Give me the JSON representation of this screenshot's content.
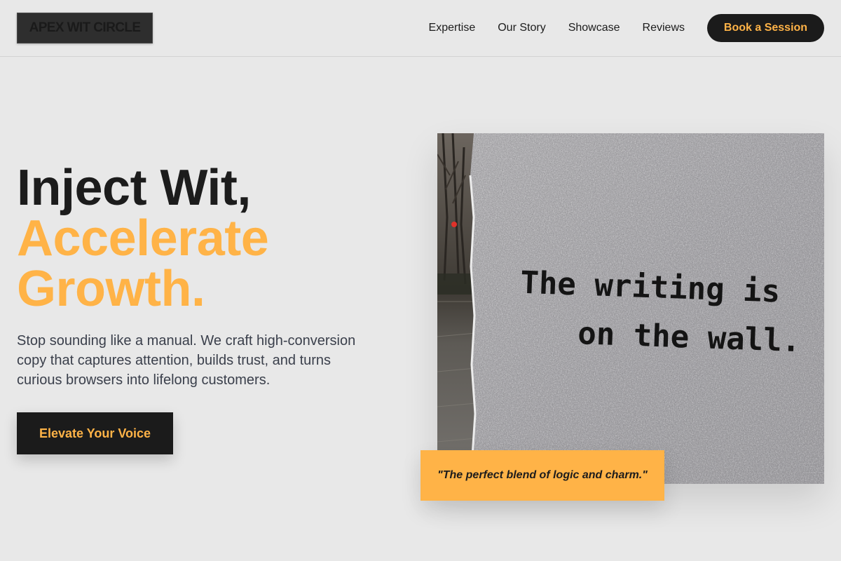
{
  "brand": {
    "name": "APEX WIT CIRCLE"
  },
  "nav": {
    "items": [
      {
        "label": "Expertise"
      },
      {
        "label": "Our Story"
      },
      {
        "label": "Showcase"
      },
      {
        "label": "Reviews"
      }
    ],
    "cta_label": "Book a Session"
  },
  "hero": {
    "title_line1": "Inject Wit,",
    "title_line2": "Accelerate",
    "title_line3": "Growth.",
    "subtitle": "Stop sounding like a manual. We craft high-conversion copy that captures attention, builds trust, and turns curious browsers into lifelong customers.",
    "button_label": "Elevate Your Voice"
  },
  "image": {
    "wall_text_line1": "The writing is",
    "wall_text_line2": "on the wall."
  },
  "quote": {
    "text": "\"The perfect blend of logic and charm.\""
  },
  "colors": {
    "accent": "#ffb347",
    "dark": "#1b1b1b",
    "background": "#e8e8e8",
    "body_text": "#3a3f4b"
  }
}
